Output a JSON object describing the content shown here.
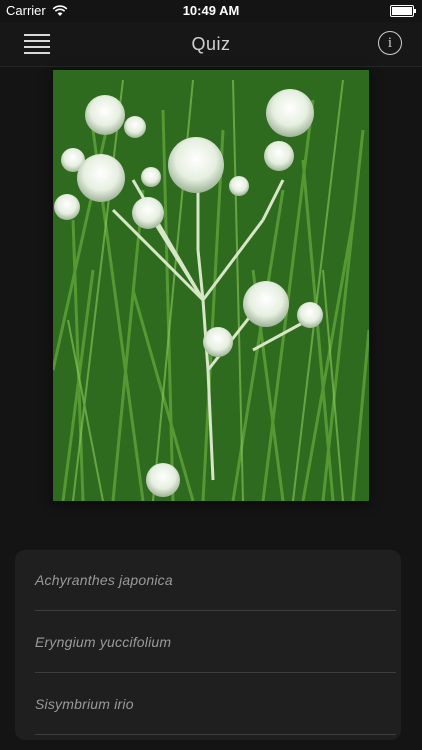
{
  "status_bar": {
    "carrier": "Carrier",
    "time": "10:49 AM",
    "wifi_icon": "wifi-icon",
    "battery_icon": "battery-icon"
  },
  "nav": {
    "title": "Quiz",
    "menu_icon": "hamburger-menu-icon",
    "info_label": "i"
  },
  "photo": {
    "subject": "white globular flower heads on green grass-like leaves"
  },
  "answers": [
    {
      "label": "Achyranthes japonica"
    },
    {
      "label": "Eryngium yuccifolium"
    },
    {
      "label": "Sisymbrium irio"
    }
  ],
  "colors": {
    "background": "#141414",
    "panel": "#1f1f1f",
    "answer_text": "#9a9a9a",
    "separator": "#3d3d3d"
  }
}
